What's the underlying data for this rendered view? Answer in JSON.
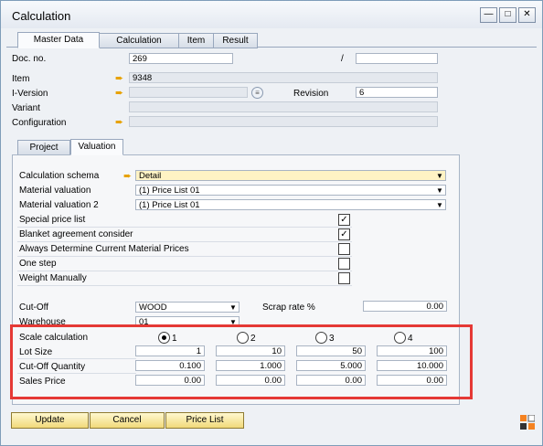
{
  "window": {
    "title": "Calculation",
    "minimize_label": "—",
    "maximize_label": "□",
    "close_label": "✕"
  },
  "top_tabs": [
    "Master Data",
    "Calculation",
    "Item",
    "Result"
  ],
  "header": {
    "doc_no_label": "Doc. no.",
    "doc_no_value": "269",
    "slash": "/",
    "item_label": "Item",
    "item_value": "9348",
    "iversion_label": "I-Version",
    "iversion_value": "",
    "revision_label": "Revision",
    "revision_value": "6",
    "variant_label": "Variant",
    "configuration_label": "Configuration"
  },
  "sub_tabs": [
    "Project",
    "Valuation"
  ],
  "valuation": {
    "calc_schema_label": "Calculation schema",
    "calc_schema_value": "Detail",
    "material_valuation_label": "Material valuation",
    "material_valuation_value": "(1) Price List 01",
    "material_valuation2_label": "Material valuation 2",
    "material_valuation2_value": "(1) Price List 01",
    "checkboxes": [
      {
        "label": "Special price list",
        "checked": true
      },
      {
        "label": "Blanket agreement consider",
        "checked": true
      },
      {
        "label": "Always Determine Current Material Prices",
        "checked": false
      },
      {
        "label": "One step",
        "checked": false
      },
      {
        "label": "Weight Manually",
        "checked": false
      }
    ],
    "cutoff_label": "Cut-Off",
    "cutoff_value": "WOOD",
    "scrap_label": "Scrap rate %",
    "scrap_value": "0.00",
    "warehouse_label": "Warehouse",
    "warehouse_value": "01"
  },
  "scale": {
    "label": "Scale calculation",
    "options": [
      "1",
      "2",
      "3",
      "4"
    ],
    "selected": "1",
    "lot_size_label": "Lot Size",
    "lot_size": [
      "1",
      "10",
      "50",
      "100"
    ],
    "cutoff_qty_label": "Cut-Off Quantity",
    "cutoff_qty": [
      "0.100",
      "1.000",
      "5.000",
      "10.000"
    ],
    "sales_price_label": "Sales Price",
    "sales_price": [
      "0.00",
      "0.00",
      "0.00",
      "0.00"
    ]
  },
  "buttons": {
    "update": "Update",
    "cancel": "Cancel",
    "price_list": "Price List"
  },
  "icons": {
    "link_arrow": "link-arrow-icon",
    "corner": "sap-logo-icon"
  }
}
